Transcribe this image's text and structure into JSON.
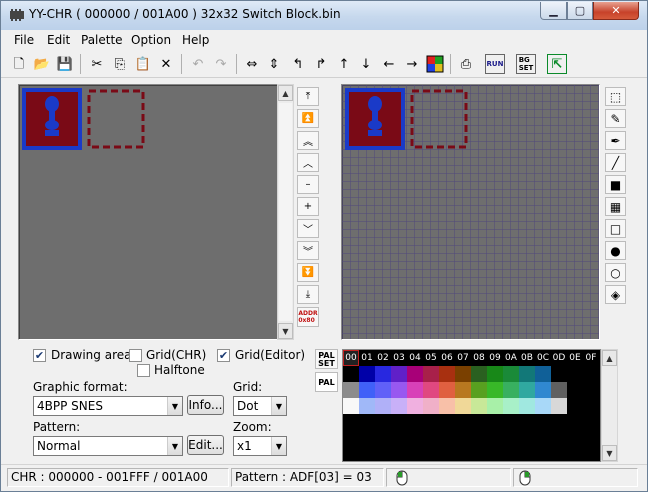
{
  "window": {
    "title": "YY-CHR ( 000000 / 001A00 ) 32x32 Switch Block.bin",
    "minimize": "0",
    "maximize": "1",
    "close": "r"
  },
  "menu": [
    "File",
    "Edit",
    "Palette",
    "Option",
    "Help"
  ],
  "toolbar_icons": [
    "new-icon",
    "open-icon",
    "save-icon",
    "cut-icon",
    "copy-icon",
    "paste-icon",
    "delete-icon",
    "undo-icon",
    "redo-icon",
    "flip-horizontal-icon",
    "flip-vertical-icon",
    "rotate-left-icon",
    "rotate-right-icon",
    "shift-up-icon",
    "shift-down-icon",
    "shift-left-icon",
    "shift-right-icon",
    "palette-replace-icon",
    "export-icon",
    "run-icon",
    "bg-set-icon",
    "exit-icon"
  ],
  "toolbar_text": {
    "run": "RUN",
    "bg_set": "BG\nSET",
    "addr": "ADDR\n0x80"
  },
  "scroll_strip": [
    "⤒",
    "⏫",
    "︽",
    "︿",
    "–",
    "+",
    "﹀",
    "︾",
    "⏬",
    "⤓"
  ],
  "options": {
    "drawing_area": {
      "label": "Drawing area",
      "checked": true
    },
    "grid_chr": {
      "label": "Grid(CHR)",
      "checked": false
    },
    "grid_editor": {
      "label": "Grid(Editor)",
      "checked": true
    },
    "halftone": {
      "label": "Halftone",
      "checked": false
    }
  },
  "graphic_format": {
    "label": "Graphic format:",
    "value": "4BPP SNES",
    "info_button": "Info..."
  },
  "grid": {
    "label": "Grid:",
    "value": "Dot"
  },
  "pattern": {
    "label": "Pattern:",
    "value": "Normal",
    "edit_button": "Edit..."
  },
  "zoom": {
    "label": "Zoom:",
    "value": "x1"
  },
  "palette_tabs": {
    "pal_set": "PAL\nSET",
    "pal": "PAL"
  },
  "palette_indices": [
    "00",
    "01",
    "02",
    "03",
    "04",
    "05",
    "06",
    "07",
    "08",
    "09",
    "0A",
    "0B",
    "0C",
    "0D",
    "0E",
    "0F"
  ],
  "palette_rows": [
    [
      "#000000",
      "#0000a8",
      "#2828e0",
      "#6020c8",
      "#a80078",
      "#a8204a",
      "#a83010",
      "#7a4000",
      "#2a6020",
      "#188818",
      "#1a8a38",
      "#127878",
      "#106098",
      "#000000",
      "#000000",
      "#000000"
    ],
    [
      "#8c8c8c",
      "#4060f8",
      "#6060f8",
      "#9858f0",
      "#d840b8",
      "#e04880",
      "#e06040",
      "#b87820",
      "#58a020",
      "#38b828",
      "#38b060",
      "#30a8a0",
      "#3088d0",
      "#606060",
      "#000000",
      "#000000"
    ],
    [
      "#f8f8f8",
      "#a0b8f8",
      "#b0b0f8",
      "#c8b0f8",
      "#f0b0e0",
      "#f0b0c8",
      "#f8c0a8",
      "#f0d898",
      "#c8e898",
      "#a8f0a8",
      "#a8f0c8",
      "#a0e8e0",
      "#a8d8f8",
      "#d8d8d8",
      "#000000",
      "#000000"
    ]
  ],
  "status": {
    "chr": "CHR : 000000 - 001FFF / 001A00",
    "pattern": "Pattern : ADF[03] = 03"
  },
  "colors": {
    "tile_bg": "#7a0a16",
    "tile_border": "#1a3ac8",
    "tile_glyph": "#1a3ac8",
    "dash": "#7a0a16",
    "canvas": "#6e6e6e"
  }
}
